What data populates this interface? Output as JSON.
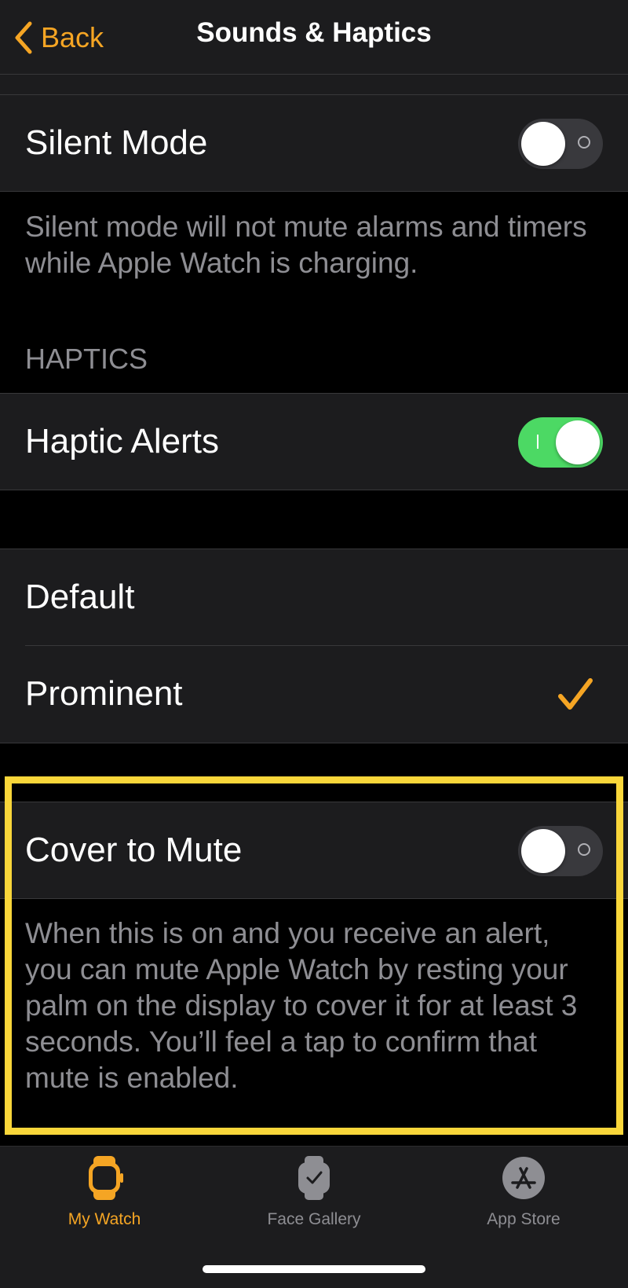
{
  "nav": {
    "back_label": "Back",
    "title": "Sounds & Haptics"
  },
  "silent_mode": {
    "label": "Silent Mode",
    "enabled": false,
    "footnote": "Silent mode will not mute alarms and timers while Apple Watch is charging."
  },
  "haptics": {
    "header": "HAPTICS",
    "alerts_label": "Haptic Alerts",
    "alerts_enabled": true,
    "options": [
      {
        "label": "Default",
        "selected": false
      },
      {
        "label": "Prominent",
        "selected": true
      }
    ]
  },
  "cover_to_mute": {
    "label": "Cover to Mute",
    "enabled": false,
    "footnote": "When this is on and you receive an alert, you can mute Apple Watch by resting your palm on the display to cover it for at least 3 seconds. You’ll feel a tap to confirm that mute is enabled."
  },
  "tabbar": {
    "tabs": [
      {
        "label": "My Watch",
        "icon": "watch-icon",
        "active": true
      },
      {
        "label": "Face Gallery",
        "icon": "face-gallery-icon",
        "active": false
      },
      {
        "label": "App Store",
        "icon": "app-store-icon",
        "active": false
      }
    ]
  },
  "colors": {
    "accent": "#f5a524",
    "toggle_on": "#4cd964",
    "highlight": "#f9d63a",
    "background": "#000000",
    "cell": "#1c1c1e",
    "secondary_text": "#8e8e93"
  }
}
